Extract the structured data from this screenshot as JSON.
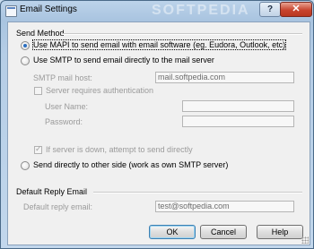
{
  "window": {
    "title": "Email Settings",
    "watermark": "SOFTPEDIA",
    "help_glyph": "?",
    "close_glyph": "✕"
  },
  "send_method": {
    "title": "Send Method",
    "options": {
      "mapi": {
        "label": "Use MAPI to send email with email software (eg. Eudora, Outlook, etc)",
        "selected": true
      },
      "smtp": {
        "label": "Use SMTP to send email directly to the mail server",
        "selected": false
      },
      "direct": {
        "label": "Send directly to other side (work as own SMTP server)",
        "selected": false
      }
    },
    "smtp": {
      "host_label": "SMTP mail host:",
      "host_value": "mail.softpedia.com",
      "auth_label": "Server requires authentication",
      "auth_checked": false,
      "username_label": "User Name:",
      "username_value": "",
      "password_label": "Password:",
      "password_value": "",
      "fallback_label": "If server is down, attempt to send directly",
      "fallback_checked": true
    }
  },
  "default_reply": {
    "title": "Default Reply Email",
    "label": "Default reply email:",
    "value": "test@softpedia.com"
  },
  "buttons": {
    "ok": "OK",
    "cancel": "Cancel",
    "help": "Help"
  }
}
